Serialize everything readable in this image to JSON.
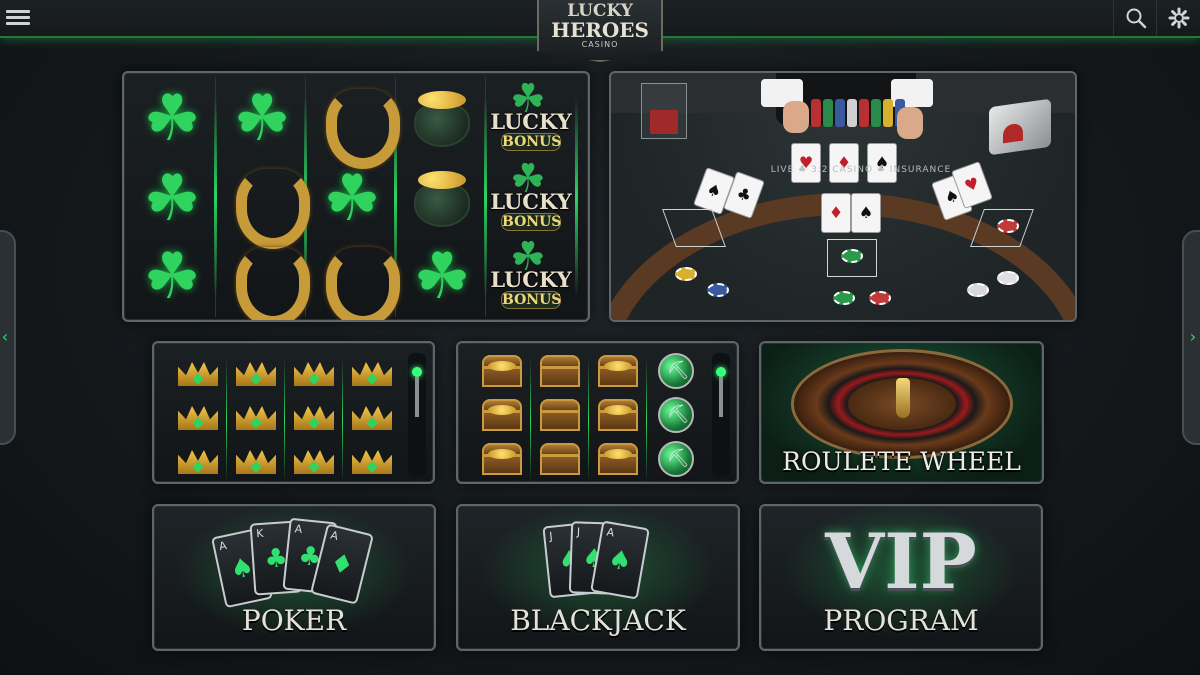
{
  "logo": {
    "line1": "LUCKY",
    "line2": "HEROES",
    "line3": "CASINO"
  },
  "header": {
    "menu_icon": "hamburger-icon",
    "search_icon": "search-icon",
    "settings_icon": "gear-icon"
  },
  "nav": {
    "prev_glyph": "‹",
    "next_glyph": "›"
  },
  "slot_main": {
    "lucky_line1": "LUCKY",
    "lucky_line2": "BONUS",
    "reels": [
      [
        "clover",
        "clover",
        "clover"
      ],
      [
        "clover",
        "horseshoe",
        "horseshoe"
      ],
      [
        "horseshoe",
        "clover",
        "horseshoe"
      ],
      [
        "pot-of-gold",
        "pot-of-gold",
        "clover"
      ],
      [
        "lucky-bonus",
        "lucky-bonus",
        "lucky-bonus"
      ]
    ]
  },
  "blackjack_live": {
    "table_text": "LIVE ♣ 3:2 CASINO ♣ INSURANCE"
  },
  "crown_slot": {
    "symbol": "crown"
  },
  "chest_slot": {
    "symbols": [
      "chest",
      "chest",
      "chest",
      "emerald"
    ]
  },
  "roulette": {
    "label": "ROULETE WHEEL"
  },
  "tiles": {
    "poker": {
      "label": "POKER",
      "cards": [
        {
          "rank": "A",
          "suit": "♠"
        },
        {
          "rank": "K",
          "suit": "♣"
        },
        {
          "rank": "A",
          "suit": "♣"
        },
        {
          "rank": "A",
          "suit": "♦"
        }
      ]
    },
    "blackjack": {
      "label": "BLACKJACK",
      "cards": [
        {
          "rank": "J",
          "suit": "♠"
        },
        {
          "rank": "J",
          "suit": "♠"
        },
        {
          "rank": "A",
          "suit": "♠"
        }
      ]
    },
    "vip": {
      "big": "VIP",
      "label": "PROGRAM"
    }
  },
  "colors": {
    "accent": "#2fd35e",
    "gold": "#c99a3a",
    "panel_border": "#5f6669"
  }
}
